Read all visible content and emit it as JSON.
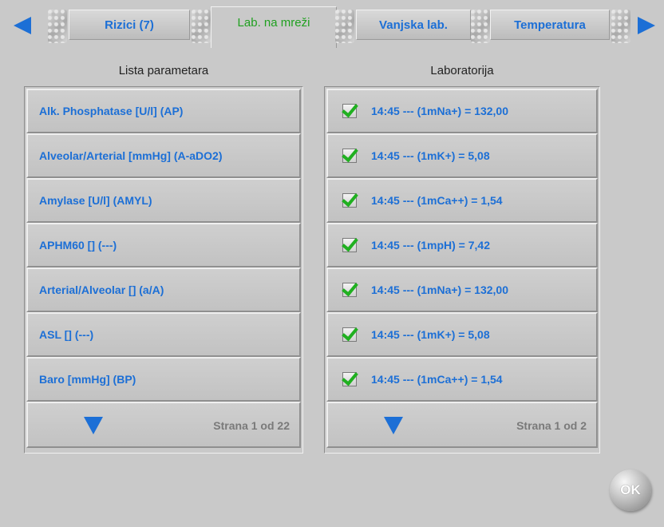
{
  "tabs": {
    "items": [
      {
        "label": "Rizici (7)"
      },
      {
        "label": "Lab. na mreži"
      },
      {
        "label": "Vanjska lab."
      },
      {
        "label": "Temperatura"
      }
    ],
    "active_index": 1,
    "colors": {
      "accent": "#1c6fd6",
      "active": "#20a020"
    }
  },
  "left_panel": {
    "title": "Lista parametara",
    "items": [
      {
        "label": "Alk. Phosphatase [U/l] (AP)"
      },
      {
        "label": "Alveolar/Arterial [mmHg] (A-aDO2)"
      },
      {
        "label": "Amylase [U/l] (AMYL)"
      },
      {
        "label": "APHM60 [] (---)"
      },
      {
        "label": "Arterial/Alveolar [] (a/A)"
      },
      {
        "label": "ASL [] (---)"
      },
      {
        "label": "Baro [mmHg] (BP)"
      }
    ],
    "page_label": "Strana 1 od 22"
  },
  "right_panel": {
    "title": "Laboratorija",
    "items": [
      {
        "label": "14:45 --- (1mNa+) = 132,00",
        "checked": true
      },
      {
        "label": "14:45 --- (1mK+) = 5,08",
        "checked": true
      },
      {
        "label": "14:45 --- (1mCa++) = 1,54",
        "checked": true
      },
      {
        "label": "14:45 --- (1mpH) = 7,42",
        "checked": true
      },
      {
        "label": "14:45 --- (1mNa+) = 132,00",
        "checked": true
      },
      {
        "label": "14:45 --- (1mK+) = 5,08",
        "checked": true
      },
      {
        "label": "14:45 --- (1mCa++) = 1,54",
        "checked": true
      }
    ],
    "page_label": "Strana 1 od 2"
  },
  "ok_button": {
    "label": "OK"
  },
  "icons": {
    "prev": "arrow-left-icon",
    "next": "arrow-right-icon",
    "page_down": "triangle-down-icon",
    "check": "checkmark-icon"
  }
}
